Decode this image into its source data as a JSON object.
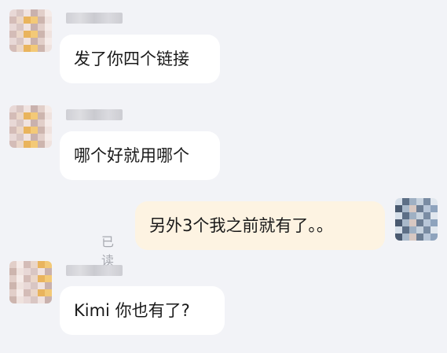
{
  "conversation": {
    "messages": [
      {
        "id": "m1",
        "direction": "incoming",
        "text": "发了你四个链接"
      },
      {
        "id": "m2",
        "direction": "incoming",
        "text": "哪个好就用哪个"
      },
      {
        "id": "m3",
        "direction": "outgoing",
        "text": "另外3个我之前就有了。。",
        "status": "已读"
      },
      {
        "id": "m4",
        "direction": "incoming",
        "text": "Kimi 你也有了?"
      }
    ]
  },
  "colors": {
    "background": "#f2f3f7",
    "incoming_bubble": "#ffffff",
    "outgoing_bubble": "#fdf3e2",
    "status_text": "#a7a9b0"
  }
}
